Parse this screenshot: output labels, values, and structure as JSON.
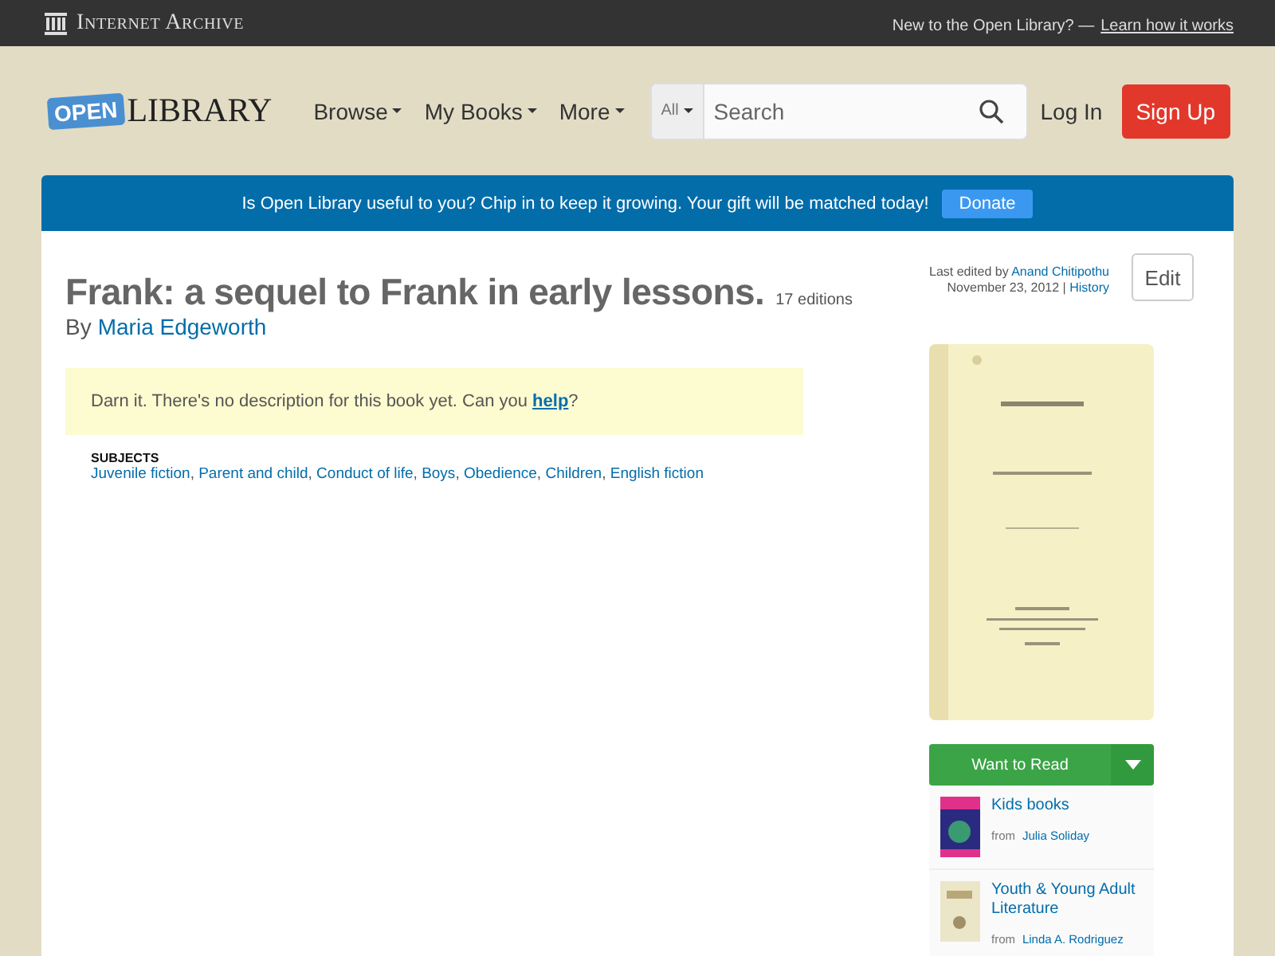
{
  "top_bar": {
    "brand": "Internet Archive",
    "prompt": "New to the Open Library? —",
    "link": "Learn how it works"
  },
  "header": {
    "logo_badge": "OPEN",
    "logo_text": "LIBRARY",
    "nav": [
      "Browse",
      "My Books",
      "More"
    ],
    "search": {
      "scope": "All",
      "placeholder": "Search"
    },
    "login": "Log In",
    "signup": "Sign Up"
  },
  "banner": {
    "text": "Is Open Library useful to you? Chip in to keep it growing. Your gift will be matched today!",
    "button": "Donate"
  },
  "book": {
    "title": "Frank: a sequel to Frank in early lessons.",
    "editions": "17 editions",
    "by": "By",
    "author": "Maria Edgeworth",
    "description": "Darn it. There's no description for this book yet. Can you **help**?",
    "subjects_heading": "SUBJECTS",
    "subject_separator": ",",
    "subjects": [
      "Juvenile fiction",
      "Parent and child",
      "Conduct of life",
      "Boys",
      "Obedience",
      "Children",
      "English fiction"
    ]
  },
  "edit_info": {
    "prefix": "Last edited by",
    "editor": "Anand Chitipothu",
    "date": "November 23, 2012 |",
    "history": "History",
    "edit_button": "Edit"
  },
  "want_to_read": {
    "label": "Want to Read"
  },
  "lists": [
    {
      "name": "Kids books",
      "from": "from",
      "owner": "Julia Soliday"
    },
    {
      "name": "Youth & Young Adult Literature",
      "from": "from",
      "owner": "Linda A. Rodriguez"
    }
  ]
}
